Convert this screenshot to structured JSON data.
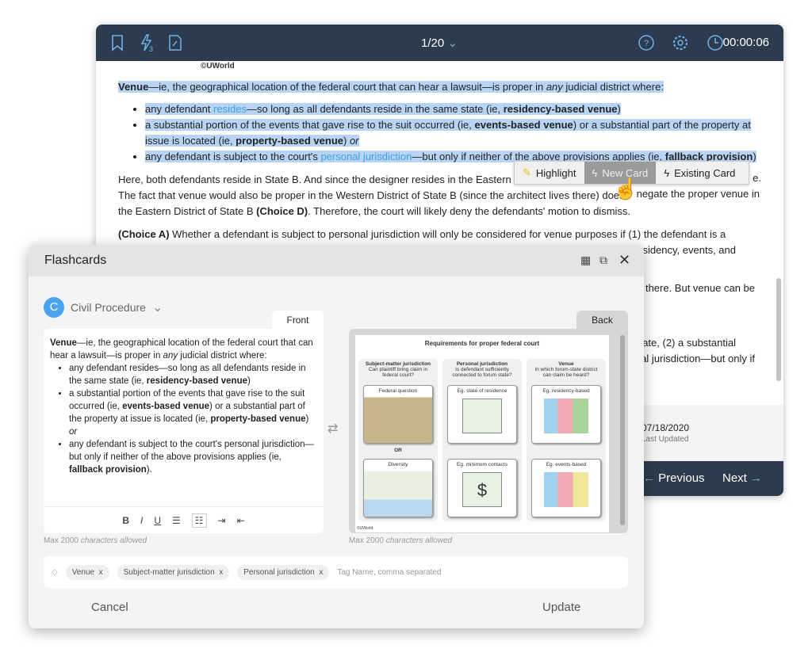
{
  "header": {
    "flashcard_count": "3",
    "page": "1/20",
    "timer": "00:00:06"
  },
  "content": {
    "copyright": "©UWorld",
    "venue_term": "Venue",
    "venue_intro_a": "—ie, the geographical location of the federal court that can hear a lawsuit—is proper in ",
    "venue_intro_any": "any",
    "venue_intro_b": " judicial district where:",
    "b1a": "any defendant ",
    "b1link": "resides",
    "b1b": "—so long as all defendants reside in the same state (ie, ",
    "b1bold": "residency-based venue",
    "b1c": ")",
    "b2a": "a substantial portion of the events that gave rise to the suit occurred (ie, ",
    "b2bold": "events-based venue",
    "b2b": ") or a substantial part of the property at issue is located (ie, ",
    "b2bold2": "property-based venue",
    "b2c": ") ",
    "b2or": "or",
    "b3a": "any defendant is subject to the court's ",
    "b3link": "personal jurisdiction",
    "b3b": "—but only if neither of the above provisions applies (ie, ",
    "b3bold": "fallback provision",
    "b3c": ")",
    "p1": "Here, both defendants reside in State B.  And since the designer resides in the Eastern D",
    "p1end": "e.",
    "p2a": "The fact that venue would also be proper in the Western District of State B (since the architect lives there) does",
    "p2b": "negate the proper venue in",
    "p3a": "the Eastern District of State B ",
    "p3bold": "(Choice D)",
    "p3b": ".  Therefore, the court will likely deny the defendants' motion to dismiss.",
    "p4bold": "(Choice A)",
    "p4": "  Whether a defendant is subject to personal jurisdiction will only be considered for venue purposes if (1) the defendant is a",
    "f1": "sidency, events, and",
    "f2": "there.  But venue can be",
    "f3": "ate, (2) a substantial",
    "f4": "al jurisdiction—but only if"
  },
  "popup": {
    "highlight": "Highlight",
    "new_card": "New Card",
    "existing_card": "Existing Card"
  },
  "footer": {
    "date": "07/18/2020",
    "date_label": "Last Updated",
    "previous": "Previous",
    "next": "Next"
  },
  "flashcards": {
    "title": "Flashcards",
    "deck_initial": "C",
    "deck": "Civil Procedure",
    "front_tab": "Front",
    "back_tab": "Back",
    "front": {
      "term": "Venue",
      "a": "—ie, the geographical location of the federal court that can hear a lawsuit—is proper in ",
      "any": "any",
      "b": " judicial district where:",
      "b1a": "any defendant resides—so long as all defendants reside in the same state (ie, ",
      "b1bold": "residency-based venue",
      "b1c": ")",
      "b2a": "a substantial portion of the events that gave rise to the suit occurred (ie, ",
      "b2bold": "events-based venue",
      "b2b": ") or a substantial part of the property at issue is located (ie, ",
      "b2bold2": "property-based venue",
      "b2c": ") ",
      "b2or": "or",
      "b3a": "any defendant is subject to the court's personal jurisdiction—but only if neither of the above provisions applies (ie, ",
      "b3bold": "fallback provision",
      "b3c": ")."
    },
    "toolbar": [
      "B",
      "I",
      "U"
    ],
    "max_note_num": "Max 2000",
    "max_note_txt": " characters allowed",
    "diagram": {
      "title": "Requirements for proper federal court",
      "cols": [
        {
          "head": "Subject-matter jurisdiction",
          "q": "Can plaintiff bring claim in federal court?",
          "box1": "Federal question",
          "box2": "Diversity"
        },
        {
          "head": "Personal jurisdiction",
          "q": "Is defendant sufficiently connected to forum state?",
          "box1": "Eg. state of residence",
          "box2": "Eg. minimum contacts"
        },
        {
          "head": "Venue",
          "q": "In which forum-state district can claim be heard?",
          "box1": "Eg. residency-based",
          "box2": "Eg. events-based"
        }
      ],
      "or": "OR",
      "dollar": "$",
      "copyright": "©UWorld"
    },
    "tags": [
      "Venue",
      "Subject-matter jurisdiction",
      "Personal jurisdiction"
    ],
    "tag_x": "x",
    "tag_placeholder": "Tag Name, comma separated",
    "cancel": "Cancel",
    "update": "Update"
  },
  "colors": {
    "header": "#2c3c4e",
    "accent": "#3ba3e4",
    "selection": "#b8d4f5"
  }
}
